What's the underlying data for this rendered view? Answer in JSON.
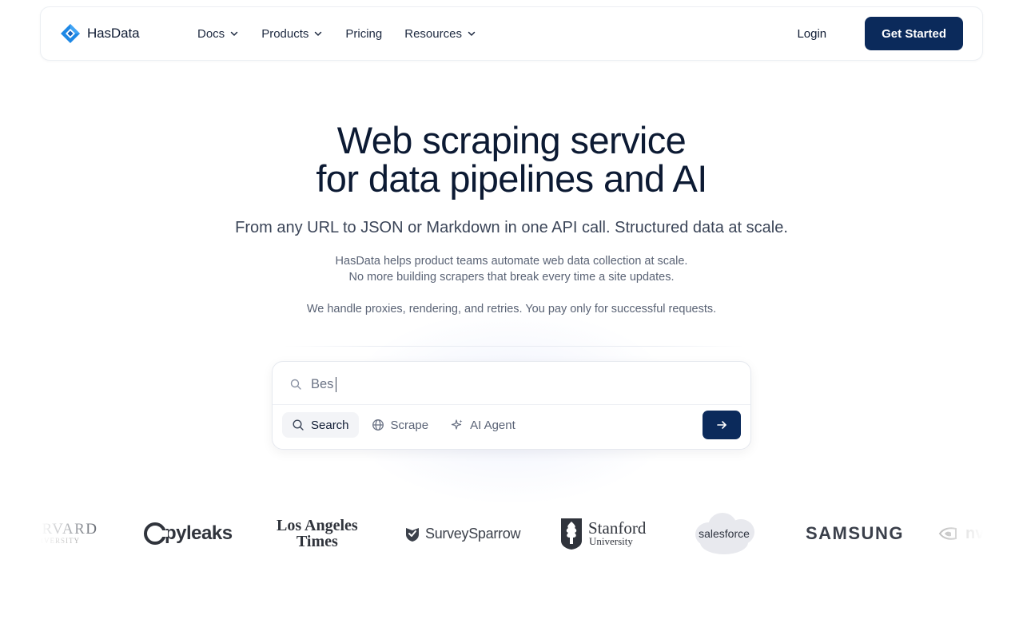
{
  "nav": {
    "brand": "HasData",
    "items": [
      {
        "label": "Docs",
        "has_dropdown": true
      },
      {
        "label": "Products",
        "has_dropdown": true
      },
      {
        "label": "Pricing",
        "has_dropdown": false
      },
      {
        "label": "Resources",
        "has_dropdown": true
      }
    ],
    "login": "Login",
    "cta": "Get Started"
  },
  "hero": {
    "title_line1": "Web scraping service",
    "title_line2": "for data pipelines and AI",
    "subtitle": "From any URL to JSON or Markdown in one API call. Structured data at scale.",
    "desc_line1": "HasData helps product teams automate web data collection at scale.",
    "desc_line2": "No more building scrapers that break every time a site updates.",
    "desc_line3": "We handle proxies, rendering, and retries. You pay only for successful requests."
  },
  "search": {
    "value": "Bes",
    "modes": [
      {
        "label": "Search",
        "icon": "search-icon",
        "active": true
      },
      {
        "label": "Scrape",
        "icon": "globe-icon",
        "active": false
      },
      {
        "label": "AI Agent",
        "icon": "sparkle-icon",
        "active": false
      }
    ],
    "submit_icon": "arrow-right-icon"
  },
  "logos": {
    "harvard_a": "HARVARD",
    "harvard_b": "UNIVERSITY",
    "copyleaks": "pyleaks",
    "lat_a": "Los Angeles",
    "lat_b": "Times",
    "surveysparrow": "SurveySparrow",
    "stanford_a": "Stanford",
    "stanford_b": "University",
    "salesforce": "salesforce",
    "samsung": "SAMSUNG",
    "nvidia": "nv"
  },
  "colors": {
    "primary": "#0b2a5b",
    "brand_blue": "#1e88e5",
    "text": "#0c1a33"
  }
}
